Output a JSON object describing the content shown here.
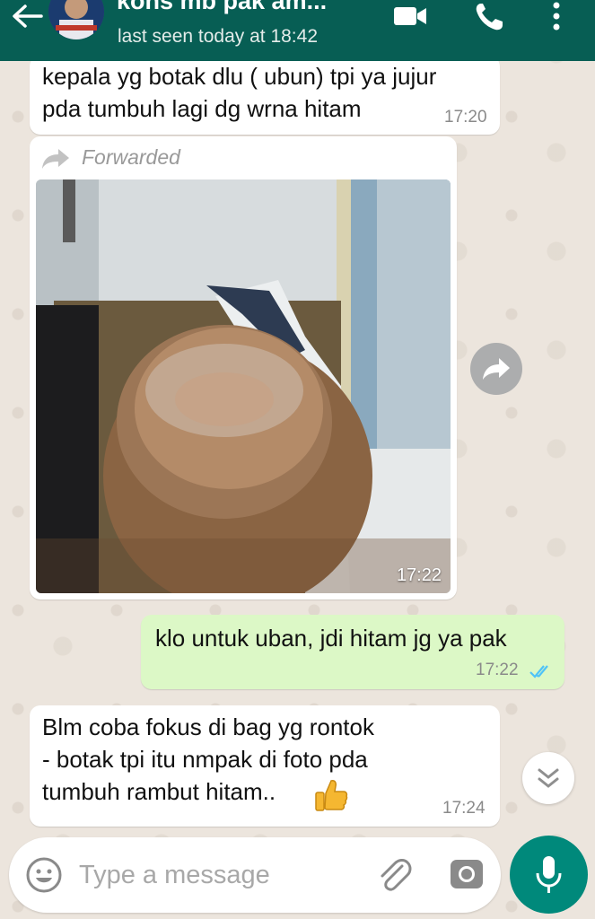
{
  "header": {
    "title": "kons mb pak am...",
    "subtitle": "last seen today at 18:42",
    "bg_color": "#075e54",
    "icons": [
      "back-arrow-icon",
      "video-call-icon",
      "voice-call-icon",
      "more-options-icon"
    ]
  },
  "messages": [
    {
      "direction": "incoming",
      "text": "kepala yg botak dlu ( ubun) tpi ya jujur\npda tumbuh lagi dg wrna hitam",
      "time": "17:20"
    },
    {
      "direction": "incoming",
      "type": "image",
      "forwarded_label": "Forwarded",
      "time": "17:22"
    },
    {
      "direction": "outgoing",
      "text": "klo untuk uban, jdi hitam jg ya pak",
      "time": "17:22",
      "status": "read",
      "status_color": "#4fc3f7"
    },
    {
      "direction": "incoming",
      "text": "Blm coba fokus di bag yg rontok\n- botak tpi itu nmpak di foto pda\ntumbuh rambut hitam..",
      "emoji": "thumbs-up-icon",
      "time": "17:24"
    }
  ],
  "composer": {
    "placeholder": "Type a message",
    "value": "",
    "icons": [
      "emoji-icon",
      "attach-icon",
      "camera-icon",
      "mic-icon"
    ],
    "mic_color": "#00897b"
  },
  "colors": {
    "outgoing_bubble": "#dcf8c6",
    "incoming_bubble": "#ffffff",
    "wallpaper": "#ece5dd"
  }
}
